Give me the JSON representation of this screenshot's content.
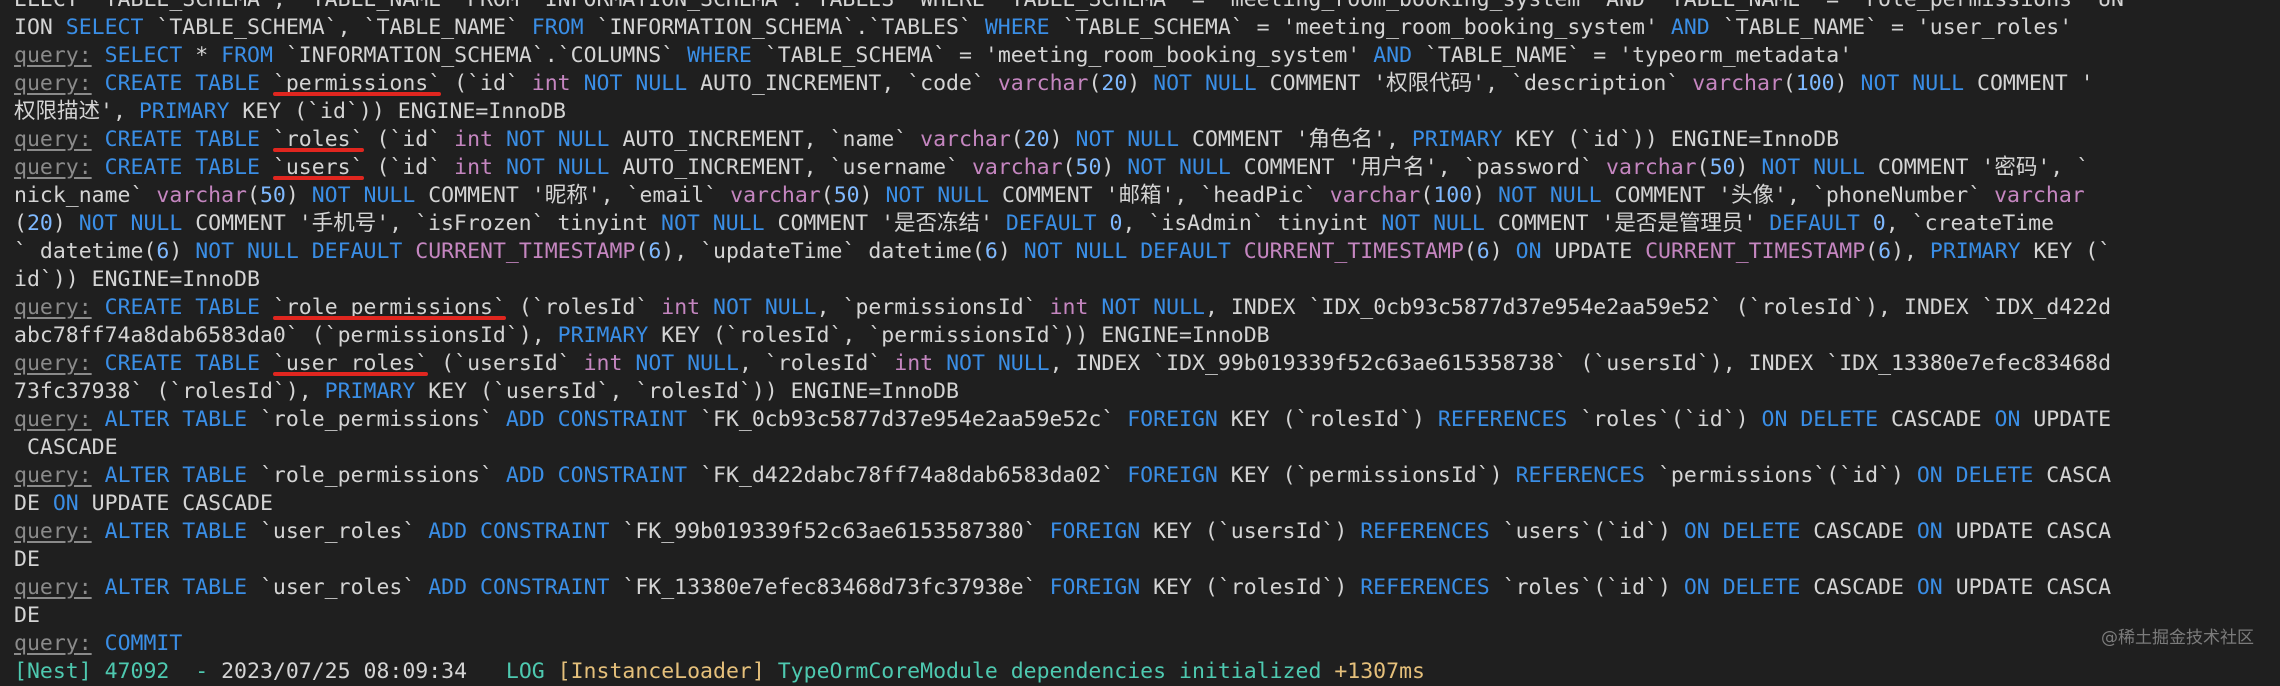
{
  "colors": {
    "background": "#1f1f1f",
    "keyword": "#3a8ee6",
    "type": "#c586c0",
    "text": "#d4d4d4",
    "prefix": "#8a8a8a",
    "highlight_underline": "#e0261f"
  },
  "log_lines": [
    [
      {
        "c": "d",
        "t": "ELECT `TABLE_SCHEMA`, `TABLE_NAME` FROM `INFORMATION_SCHEMA`.`TABLES` WHERE `TABLE_SCHEMA` = 'meeting_room_booking_system' AND `TABLE_NAME` = 'role_permissions' UN"
      }
    ],
    [
      {
        "c": "d",
        "t": "ION "
      },
      {
        "c": "k",
        "t": "SELECT"
      },
      {
        "c": "d",
        "t": " `TABLE_SCHEMA`, `TABLE_NAME` "
      },
      {
        "c": "k",
        "t": "FROM"
      },
      {
        "c": "d",
        "t": " `INFORMATION_SCHEMA`.`TABLES` "
      },
      {
        "c": "k",
        "t": "WHERE"
      },
      {
        "c": "d",
        "t": " `TABLE_SCHEMA` = 'meeting_room_booking_system' "
      },
      {
        "c": "k",
        "t": "AND"
      },
      {
        "c": "d",
        "t": " `TABLE_NAME` = 'user_roles'"
      }
    ],
    [
      {
        "c": "q",
        "t": "query:"
      },
      {
        "c": "d",
        "t": " "
      },
      {
        "c": "k",
        "t": "SELECT"
      },
      {
        "c": "d",
        "t": " * "
      },
      {
        "c": "k",
        "t": "FROM"
      },
      {
        "c": "d",
        "t": " `INFORMATION_SCHEMA`.`COLUMNS` "
      },
      {
        "c": "k",
        "t": "WHERE"
      },
      {
        "c": "d",
        "t": " `TABLE_SCHEMA` = 'meeting_room_booking_system' "
      },
      {
        "c": "k",
        "t": "AND"
      },
      {
        "c": "d",
        "t": " `TABLE_NAME` = 'typeorm_metadata'"
      }
    ],
    [
      {
        "c": "q",
        "t": "query:"
      },
      {
        "c": "d",
        "t": " "
      },
      {
        "c": "k",
        "t": "CREATE TABLE"
      },
      {
        "c": "d",
        "t": " `permissions` (`id` "
      },
      {
        "c": "t",
        "t": "int"
      },
      {
        "c": "d",
        "t": " "
      },
      {
        "c": "k",
        "t": "NOT NULL"
      },
      {
        "c": "d",
        "t": " AUTO_INCREMENT, `code` "
      },
      {
        "c": "t",
        "t": "varchar"
      },
      {
        "c": "d",
        "t": "("
      },
      {
        "c": "n",
        "t": "20"
      },
      {
        "c": "d",
        "t": ") "
      },
      {
        "c": "k",
        "t": "NOT NULL"
      },
      {
        "c": "d",
        "t": " COMMENT '权限代码', `description` "
      },
      {
        "c": "t",
        "t": "varchar"
      },
      {
        "c": "d",
        "t": "("
      },
      {
        "c": "n",
        "t": "100"
      },
      {
        "c": "d",
        "t": ") "
      },
      {
        "c": "k",
        "t": "NOT NULL"
      },
      {
        "c": "d",
        "t": " COMMENT '"
      }
    ],
    [
      {
        "c": "d",
        "t": "权限描述', "
      },
      {
        "c": "k",
        "t": "PRIMARY"
      },
      {
        "c": "d",
        "t": " KEY (`id`)) ENGINE=InnoDB"
      }
    ],
    [
      {
        "c": "q",
        "t": "query:"
      },
      {
        "c": "d",
        "t": " "
      },
      {
        "c": "k",
        "t": "CREATE TABLE"
      },
      {
        "c": "d",
        "t": " `roles` (`id` "
      },
      {
        "c": "t",
        "t": "int"
      },
      {
        "c": "d",
        "t": " "
      },
      {
        "c": "k",
        "t": "NOT NULL"
      },
      {
        "c": "d",
        "t": " AUTO_INCREMENT, `name` "
      },
      {
        "c": "t",
        "t": "varchar"
      },
      {
        "c": "d",
        "t": "("
      },
      {
        "c": "n",
        "t": "20"
      },
      {
        "c": "d",
        "t": ") "
      },
      {
        "c": "k",
        "t": "NOT NULL"
      },
      {
        "c": "d",
        "t": " COMMENT '角色名', "
      },
      {
        "c": "k",
        "t": "PRIMARY"
      },
      {
        "c": "d",
        "t": " KEY (`id`)) ENGINE=InnoDB"
      }
    ],
    [
      {
        "c": "q",
        "t": "query:"
      },
      {
        "c": "d",
        "t": " "
      },
      {
        "c": "k",
        "t": "CREATE TABLE"
      },
      {
        "c": "d",
        "t": " `users` (`id` "
      },
      {
        "c": "t",
        "t": "int"
      },
      {
        "c": "d",
        "t": " "
      },
      {
        "c": "k",
        "t": "NOT NULL"
      },
      {
        "c": "d",
        "t": " AUTO_INCREMENT, `username` "
      },
      {
        "c": "t",
        "t": "varchar"
      },
      {
        "c": "d",
        "t": "("
      },
      {
        "c": "n",
        "t": "50"
      },
      {
        "c": "d",
        "t": ") "
      },
      {
        "c": "k",
        "t": "NOT NULL"
      },
      {
        "c": "d",
        "t": " COMMENT '用户名', `password` "
      },
      {
        "c": "t",
        "t": "varchar"
      },
      {
        "c": "d",
        "t": "("
      },
      {
        "c": "n",
        "t": "50"
      },
      {
        "c": "d",
        "t": ") "
      },
      {
        "c": "k",
        "t": "NOT NULL"
      },
      {
        "c": "d",
        "t": " COMMENT '密码', `"
      }
    ],
    [
      {
        "c": "d",
        "t": "nick_name` "
      },
      {
        "c": "t",
        "t": "varchar"
      },
      {
        "c": "d",
        "t": "("
      },
      {
        "c": "n",
        "t": "50"
      },
      {
        "c": "d",
        "t": ") "
      },
      {
        "c": "k",
        "t": "NOT NULL"
      },
      {
        "c": "d",
        "t": " COMMENT '昵称', `email` "
      },
      {
        "c": "t",
        "t": "varchar"
      },
      {
        "c": "d",
        "t": "("
      },
      {
        "c": "n",
        "t": "50"
      },
      {
        "c": "d",
        "t": ") "
      },
      {
        "c": "k",
        "t": "NOT NULL"
      },
      {
        "c": "d",
        "t": " COMMENT '邮箱', `headPic` "
      },
      {
        "c": "t",
        "t": "varchar"
      },
      {
        "c": "d",
        "t": "("
      },
      {
        "c": "n",
        "t": "100"
      },
      {
        "c": "d",
        "t": ") "
      },
      {
        "c": "k",
        "t": "NOT NULL"
      },
      {
        "c": "d",
        "t": " COMMENT '头像', `phoneNumber` "
      },
      {
        "c": "t",
        "t": "varchar"
      }
    ],
    [
      {
        "c": "d",
        "t": "("
      },
      {
        "c": "n",
        "t": "20"
      },
      {
        "c": "d",
        "t": ") "
      },
      {
        "c": "k",
        "t": "NOT NULL"
      },
      {
        "c": "d",
        "t": " COMMENT '手机号', `isFrozen` tinyint "
      },
      {
        "c": "k",
        "t": "NOT NULL"
      },
      {
        "c": "d",
        "t": " COMMENT '是否冻结' "
      },
      {
        "c": "k",
        "t": "DEFAULT"
      },
      {
        "c": "d",
        "t": " "
      },
      {
        "c": "n",
        "t": "0"
      },
      {
        "c": "d",
        "t": ", `isAdmin` tinyint "
      },
      {
        "c": "k",
        "t": "NOT NULL"
      },
      {
        "c": "d",
        "t": " COMMENT '是否是管理员' "
      },
      {
        "c": "k",
        "t": "DEFAULT"
      },
      {
        "c": "d",
        "t": " "
      },
      {
        "c": "n",
        "t": "0"
      },
      {
        "c": "d",
        "t": ", `createTime"
      }
    ],
    [
      {
        "c": "d",
        "t": "` datetime("
      },
      {
        "c": "n",
        "t": "6"
      },
      {
        "c": "d",
        "t": ") "
      },
      {
        "c": "k",
        "t": "NOT NULL DEFAULT"
      },
      {
        "c": "d",
        "t": " "
      },
      {
        "c": "t",
        "t": "CURRENT_TIMESTAMP"
      },
      {
        "c": "d",
        "t": "("
      },
      {
        "c": "n",
        "t": "6"
      },
      {
        "c": "d",
        "t": "), `updateTime` datetime("
      },
      {
        "c": "n",
        "t": "6"
      },
      {
        "c": "d",
        "t": ") "
      },
      {
        "c": "k",
        "t": "NOT NULL DEFAULT"
      },
      {
        "c": "d",
        "t": " "
      },
      {
        "c": "t",
        "t": "CURRENT_TIMESTAMP"
      },
      {
        "c": "d",
        "t": "("
      },
      {
        "c": "n",
        "t": "6"
      },
      {
        "c": "d",
        "t": ") "
      },
      {
        "c": "k",
        "t": "ON"
      },
      {
        "c": "d",
        "t": " UPDATE "
      },
      {
        "c": "t",
        "t": "CURRENT_TIMESTAMP"
      },
      {
        "c": "d",
        "t": "("
      },
      {
        "c": "n",
        "t": "6"
      },
      {
        "c": "d",
        "t": "), "
      },
      {
        "c": "k",
        "t": "PRIMARY"
      },
      {
        "c": "d",
        "t": " KEY (`"
      }
    ],
    [
      {
        "c": "d",
        "t": "id`)) ENGINE=InnoDB"
      }
    ],
    [
      {
        "c": "q",
        "t": "query:"
      },
      {
        "c": "d",
        "t": " "
      },
      {
        "c": "k",
        "t": "CREATE TABLE"
      },
      {
        "c": "d",
        "t": " `role_permissions` (`rolesId` "
      },
      {
        "c": "t",
        "t": "int"
      },
      {
        "c": "d",
        "t": " "
      },
      {
        "c": "k",
        "t": "NOT NULL"
      },
      {
        "c": "d",
        "t": ", `permissionsId` "
      },
      {
        "c": "t",
        "t": "int"
      },
      {
        "c": "d",
        "t": " "
      },
      {
        "c": "k",
        "t": "NOT NULL"
      },
      {
        "c": "d",
        "t": ", INDEX `IDX_0cb93c5877d37e954e2aa59e52` (`rolesId`), INDEX `IDX_d422d"
      }
    ],
    [
      {
        "c": "d",
        "t": "abc78ff74a8dab6583da0` (`permissionsId`), "
      },
      {
        "c": "k",
        "t": "PRIMARY"
      },
      {
        "c": "d",
        "t": " KEY (`rolesId`, `permissionsId`)) ENGINE=InnoDB"
      }
    ],
    [
      {
        "c": "q",
        "t": "query:"
      },
      {
        "c": "d",
        "t": " "
      },
      {
        "c": "k",
        "t": "CREATE TABLE"
      },
      {
        "c": "d",
        "t": " `user_roles` (`usersId` "
      },
      {
        "c": "t",
        "t": "int"
      },
      {
        "c": "d",
        "t": " "
      },
      {
        "c": "k",
        "t": "NOT NULL"
      },
      {
        "c": "d",
        "t": ", `rolesId` "
      },
      {
        "c": "t",
        "t": "int"
      },
      {
        "c": "d",
        "t": " "
      },
      {
        "c": "k",
        "t": "NOT NULL"
      },
      {
        "c": "d",
        "t": ", INDEX `IDX_99b019339f52c63ae615358738` (`usersId`), INDEX `IDX_13380e7efec83468d"
      }
    ],
    [
      {
        "c": "d",
        "t": "73fc37938` (`rolesId`), "
      },
      {
        "c": "k",
        "t": "PRIMARY"
      },
      {
        "c": "d",
        "t": " KEY (`usersId`, `rolesId`)) ENGINE=InnoDB"
      }
    ],
    [
      {
        "c": "q",
        "t": "query:"
      },
      {
        "c": "d",
        "t": " "
      },
      {
        "c": "k",
        "t": "ALTER TABLE"
      },
      {
        "c": "d",
        "t": " `role_permissions` "
      },
      {
        "c": "k",
        "t": "ADD CONSTRAINT"
      },
      {
        "c": "d",
        "t": " `FK_0cb93c5877d37e954e2aa59e52c` "
      },
      {
        "c": "k",
        "t": "FOREIGN"
      },
      {
        "c": "d",
        "t": " KEY (`rolesId`) "
      },
      {
        "c": "k",
        "t": "REFERENCES"
      },
      {
        "c": "d",
        "t": " `roles`(`id`) "
      },
      {
        "c": "k",
        "t": "ON DELETE"
      },
      {
        "c": "d",
        "t": " CASCADE "
      },
      {
        "c": "k",
        "t": "ON"
      },
      {
        "c": "d",
        "t": " UPDATE"
      }
    ],
    [
      {
        "c": "d",
        "t": " CASCADE"
      }
    ],
    [
      {
        "c": "q",
        "t": "query:"
      },
      {
        "c": "d",
        "t": " "
      },
      {
        "c": "k",
        "t": "ALTER TABLE"
      },
      {
        "c": "d",
        "t": " `role_permissions` "
      },
      {
        "c": "k",
        "t": "ADD CONSTRAINT"
      },
      {
        "c": "d",
        "t": " `FK_d422dabc78ff74a8dab6583da02` "
      },
      {
        "c": "k",
        "t": "FOREIGN"
      },
      {
        "c": "d",
        "t": " KEY (`permissionsId`) "
      },
      {
        "c": "k",
        "t": "REFERENCES"
      },
      {
        "c": "d",
        "t": " `permissions`(`id`) "
      },
      {
        "c": "k",
        "t": "ON DELETE"
      },
      {
        "c": "d",
        "t": " CASCA"
      }
    ],
    [
      {
        "c": "d",
        "t": "DE "
      },
      {
        "c": "k",
        "t": "ON"
      },
      {
        "c": "d",
        "t": " UPDATE CASCADE"
      }
    ],
    [
      {
        "c": "q",
        "t": "query:"
      },
      {
        "c": "d",
        "t": " "
      },
      {
        "c": "k",
        "t": "ALTER TABLE"
      },
      {
        "c": "d",
        "t": " `user_roles` "
      },
      {
        "c": "k",
        "t": "ADD CONSTRAINT"
      },
      {
        "c": "d",
        "t": " `FK_99b019339f52c63ae6153587380` "
      },
      {
        "c": "k",
        "t": "FOREIGN"
      },
      {
        "c": "d",
        "t": " KEY (`usersId`) "
      },
      {
        "c": "k",
        "t": "REFERENCES"
      },
      {
        "c": "d",
        "t": " `users`(`id`) "
      },
      {
        "c": "k",
        "t": "ON DELETE"
      },
      {
        "c": "d",
        "t": " CASCADE "
      },
      {
        "c": "k",
        "t": "ON"
      },
      {
        "c": "d",
        "t": " UPDATE CASCA"
      }
    ],
    [
      {
        "c": "d",
        "t": "DE"
      }
    ],
    [
      {
        "c": "q",
        "t": "query:"
      },
      {
        "c": "d",
        "t": " "
      },
      {
        "c": "k",
        "t": "ALTER TABLE"
      },
      {
        "c": "d",
        "t": " `user_roles` "
      },
      {
        "c": "k",
        "t": "ADD CONSTRAINT"
      },
      {
        "c": "d",
        "t": " `FK_13380e7efec83468d73fc37938e` "
      },
      {
        "c": "k",
        "t": "FOREIGN"
      },
      {
        "c": "d",
        "t": " KEY (`rolesId`) "
      },
      {
        "c": "k",
        "t": "REFERENCES"
      },
      {
        "c": "d",
        "t": " `roles`(`id`) "
      },
      {
        "c": "k",
        "t": "ON DELETE"
      },
      {
        "c": "d",
        "t": " CASCADE "
      },
      {
        "c": "k",
        "t": "ON"
      },
      {
        "c": "d",
        "t": " UPDATE CASCA"
      }
    ],
    [
      {
        "c": "d",
        "t": "DE"
      }
    ],
    [
      {
        "c": "q",
        "t": "query:"
      },
      {
        "c": "d",
        "t": " "
      },
      {
        "c": "k",
        "t": "COMMIT"
      }
    ],
    [
      {
        "c": "g",
        "t": "[Nest] 47092  - "
      },
      {
        "c": "d",
        "t": "2023/07/25 08:09:34   "
      },
      {
        "c": "g",
        "t": "LOG "
      },
      {
        "c": "y",
        "t": "[InstanceLoader] "
      },
      {
        "c": "g",
        "t": "TypeOrmCoreModule dependencies initialized "
      },
      {
        "c": "y",
        "t": "+1307ms"
      }
    ]
  ],
  "highlights": [
    {
      "line": 3,
      "text": "permissions"
    },
    {
      "line": 5,
      "text": "roles"
    },
    {
      "line": 6,
      "text": "users"
    },
    {
      "line": 11,
      "text": "role_permissions"
    },
    {
      "line": 13,
      "text": "user_roles"
    }
  ],
  "watermark": "@稀土掘金技术社区"
}
